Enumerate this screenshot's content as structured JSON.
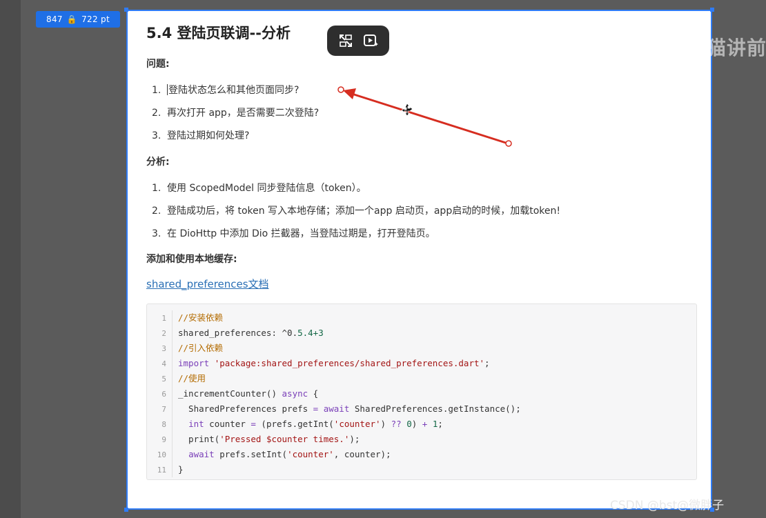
{
  "size_badge": {
    "width": "847",
    "height": "722",
    "unit": "pt"
  },
  "title": "5.4 登陆页联调--分析",
  "watermark": "程序员老猫讲前",
  "sections": {
    "questions_label": "问题:",
    "analysis_label": "分析:",
    "storage_label": "添加和使用本地缓存:"
  },
  "questions": [
    {
      "num": "1.",
      "text": "登陆状态怎么和其他页面同步?"
    },
    {
      "num": "2.",
      "text": "再次打开 app，是否需要二次登陆?"
    },
    {
      "num": "3.",
      "text": "登陆过期如何处理?"
    }
  ],
  "analysis": [
    {
      "num": "1.",
      "text": "使用 ScopedModel 同步登陆信息（token）。"
    },
    {
      "num": "2.",
      "text": "登陆成功后，将 token 写入本地存储；添加一个app 启动页，app启动的时候，加载token!"
    },
    {
      "num": "3.",
      "text": "在 DioHttp 中添加 Dio 拦截器，当登陆过期是，打开登陆页。"
    }
  ],
  "link_text": "shared_preferences文档",
  "code": {
    "line_numbers": [
      "1",
      "2",
      "3",
      "4",
      "5",
      "6",
      "7",
      "8",
      "9",
      "10",
      "11"
    ],
    "lines": {
      "l1": "//安装依赖",
      "l2_a": "shared_preferences: ^0.",
      "l2_b": "5.4",
      "l2_c": "+3",
      "l3": "//引入依赖",
      "l4_kw": "import",
      "l4_str": "'package:shared_preferences/shared_preferences.dart'",
      "l4_end": ";",
      "l5": "//使用",
      "l6_a": "_incrementCounter() ",
      "l6_kw": "async",
      "l6_b": " {",
      "l7_a": "  SharedPreferences prefs ",
      "l7_op": "=",
      "l7_b": " ",
      "l7_kw": "await",
      "l7_c": " SharedPreferences.getInstance();",
      "l8_kw": "int",
      "l8_a": " counter ",
      "l8_op1": "=",
      "l8_b": " (prefs.getInt(",
      "l8_str": "'counter'",
      "l8_c": ") ",
      "l8_op2": "??",
      "l8_d": " ",
      "l8_num1": "0",
      "l8_e": ") ",
      "l8_op3": "+",
      "l8_f": " ",
      "l8_num2": "1",
      "l8_g": ";",
      "l9_a": "  print(",
      "l9_str": "'Pressed $counter times.'",
      "l9_b": ");",
      "l10_kw": "await",
      "l10_a": " prefs.setInt(",
      "l10_str": "'counter'",
      "l10_b": ", counter);",
      "l11": "}"
    }
  },
  "footer": "CSDN @bst@微胖子",
  "colors": {
    "accent": "#2f7cf6",
    "annotation_arrow": "#d62d20",
    "link": "#2a6fb5"
  },
  "icons": {
    "toolbar": [
      "picture-in-picture-icon",
      "video-ai-icon"
    ],
    "cursor": "move-cursor-icon"
  }
}
